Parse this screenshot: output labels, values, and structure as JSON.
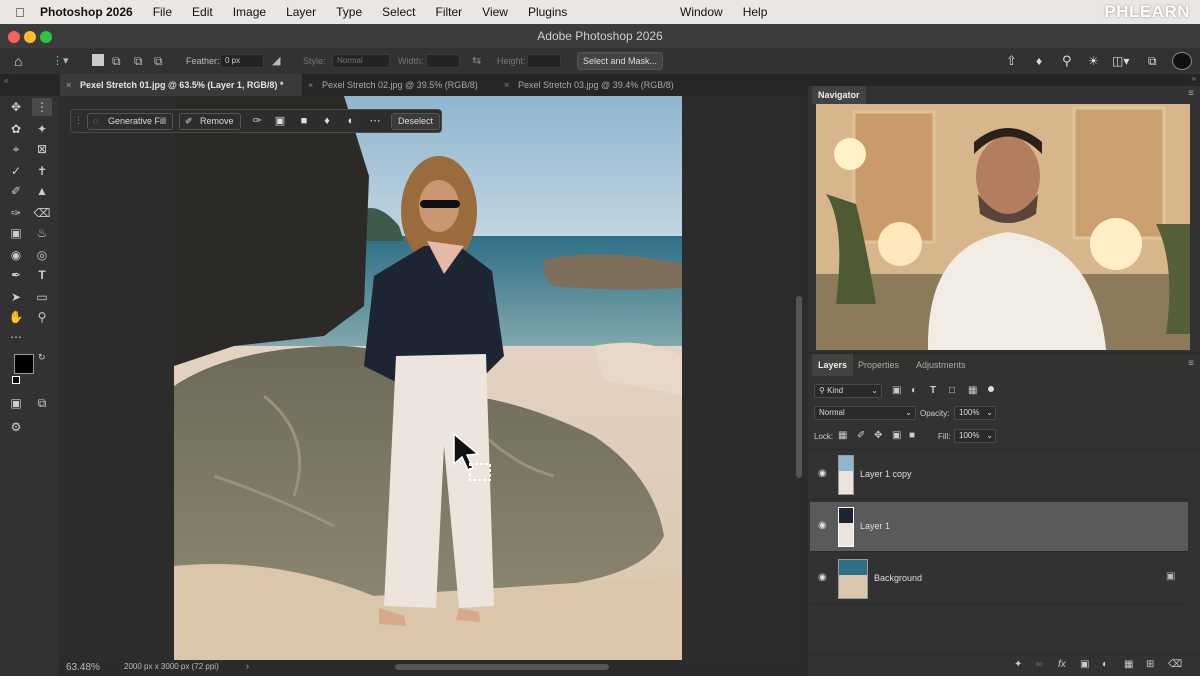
{
  "menubar": {
    "app_name": "Photoshop 2026",
    "items": [
      "File",
      "Edit",
      "Image",
      "Layer",
      "Type",
      "Select",
      "Filter",
      "View",
      "Plugins"
    ],
    "right_items": [
      "Window",
      "Help"
    ],
    "brand": "PHLEARN"
  },
  "window": {
    "title": "Adobe Photoshop 2026"
  },
  "options": {
    "feather_label": "Feather:",
    "feather_value": "0 px",
    "style_label": "Style:",
    "style_value": "Normal",
    "width_label": "Width:",
    "height_label": "Height:",
    "select_mask_label": "Select and Mask..."
  },
  "tabs": [
    {
      "label": "Pexel Stretch 01.jpg @ 63.5% (Layer 1, RGB/8) *"
    },
    {
      "label": "Pexel Stretch 02.jpg @ 39.5% (RGB/8)"
    },
    {
      "label": "Pexel Stretch 03.jpg @ 39.4% (RGB/8)"
    }
  ],
  "contextbar": {
    "generative_fill": "Generative Fill",
    "remove": "Remove",
    "deselect": "Deselect"
  },
  "status": {
    "zoom": "63.48%",
    "doc_size": "2000 px x 3000 px (72 ppi)"
  },
  "navigator": {
    "title": "Navigator"
  },
  "layers_panel": {
    "tabs": [
      "Layers",
      "Properties",
      "Adjustments"
    ],
    "kind": "Kind",
    "blend_mode": "Normal",
    "opacity_label": "Opacity:",
    "opacity_value": "100%",
    "lock_label": "Lock:",
    "fill_label": "Fill:",
    "fill_value": "100%",
    "layers": [
      {
        "name": "Layer 1 copy",
        "selected": false
      },
      {
        "name": "Layer 1",
        "selected": true
      },
      {
        "name": "Background",
        "selected": false,
        "locked": true
      }
    ]
  }
}
